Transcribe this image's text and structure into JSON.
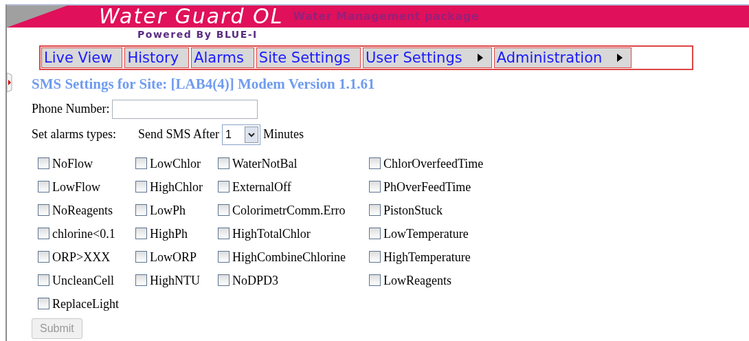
{
  "header": {
    "title": "Water Guard OL",
    "tagline": "Water Management package",
    "powered_by": "Powered By BLUE-I"
  },
  "menu": [
    {
      "label": "Live View",
      "submenu": false
    },
    {
      "label": "History",
      "submenu": false
    },
    {
      "label": "Alarms",
      "submenu": false
    },
    {
      "label": "Site Settings",
      "submenu": false
    },
    {
      "label": "User Settings",
      "submenu": true
    },
    {
      "label": "Administration",
      "submenu": true
    }
  ],
  "heading": "SMS Settings for Site: [LAB4(4)] Modem Version 1.1.61",
  "phone": {
    "label": "Phone Number:"
  },
  "alarm_types_label": "Set alarms types:",
  "send_after": {
    "label": "Send SMS After",
    "value": "1",
    "unit": "Minutes"
  },
  "alarm_rows": [
    [
      {
        "label": "NoFlow",
        "checked": false
      },
      {
        "label": "LowChlor",
        "checked": false
      },
      {
        "label": "WaterNotBal",
        "checked": false
      },
      {
        "label": "ChlorOverfeedTime",
        "checked": false
      }
    ],
    [
      {
        "label": "LowFlow",
        "checked": false
      },
      {
        "label": "HighChlor",
        "checked": false
      },
      {
        "label": "ExternalOff",
        "checked": false
      },
      {
        "label": "PhOverFeedTime",
        "checked": false
      }
    ],
    [
      {
        "label": "NoReagents",
        "checked": false
      },
      {
        "label": "LowPh",
        "checked": false
      },
      {
        "label": "ColorimetrComm.Erro",
        "checked": false
      },
      {
        "label": "PistonStuck",
        "checked": false
      }
    ],
    [
      {
        "label": "chlorine<0.1",
        "checked": false
      },
      {
        "label": "HighPh",
        "checked": false
      },
      {
        "label": "HighTotalChlor",
        "checked": false
      },
      {
        "label": "LowTemperature",
        "checked": false
      }
    ],
    [
      {
        "label": "ORP>XXX",
        "checked": false
      },
      {
        "label": "LowORP",
        "checked": false
      },
      {
        "label": "HighCombineChlorine",
        "checked": false
      },
      {
        "label": "HighTemperature",
        "checked": false
      }
    ],
    [
      {
        "label": "UncleanCell",
        "checked": false
      },
      {
        "label": "HighNTU",
        "checked": false
      },
      {
        "label": "NoDPD3",
        "checked": false
      },
      {
        "label": "LowReagents",
        "checked": false
      }
    ],
    [
      {
        "label": "ReplaceLight",
        "checked": false
      }
    ]
  ],
  "submit": {
    "label": "Submit",
    "disabled": true
  }
}
